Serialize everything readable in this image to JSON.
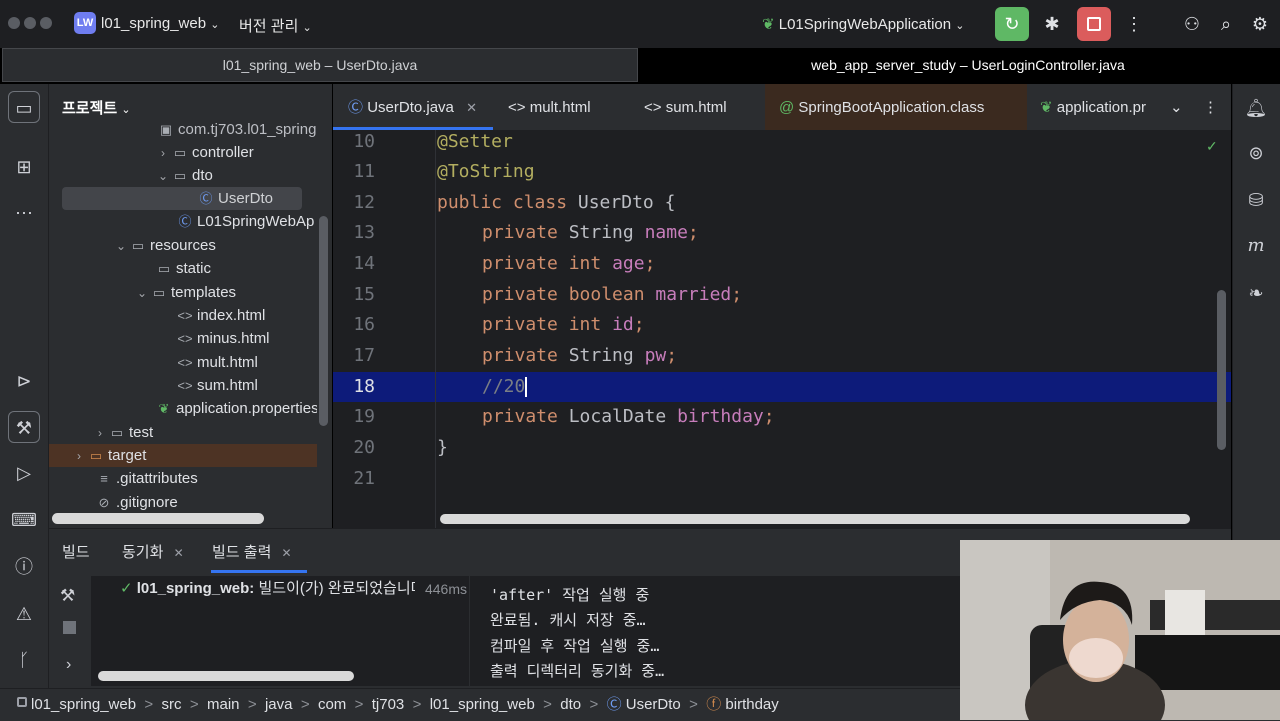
{
  "titlebar": {
    "project_badge": "LW",
    "project_name": "l01_spring_web",
    "vcs_label": "버전 관리",
    "run_config": "L01SpringWebApplication"
  },
  "window_tabs": {
    "left": "l01_spring_web – UserDto.java",
    "right": "web_app_server_study – UserLoginController.java"
  },
  "project_panel": {
    "header": "프로젝트",
    "tree": [
      {
        "label": "com.tj703.l01_spring",
        "icon": "package-icon"
      },
      {
        "label": "controller",
        "icon": "folder-icon"
      },
      {
        "label": "dto",
        "icon": "folder-icon"
      },
      {
        "label": "UserDto",
        "icon": "class-icon"
      },
      {
        "label": "L01SpringWebAp",
        "icon": "spring-class-icon"
      },
      {
        "label": "resources",
        "icon": "folder-icon"
      },
      {
        "label": "static",
        "icon": "folder-icon"
      },
      {
        "label": "templates",
        "icon": "folder-icon"
      },
      {
        "label": "index.html",
        "icon": "html-icon"
      },
      {
        "label": "minus.html",
        "icon": "html-icon"
      },
      {
        "label": "mult.html",
        "icon": "html-icon"
      },
      {
        "label": "sum.html",
        "icon": "html-icon"
      },
      {
        "label": "application.properties",
        "icon": "properties-icon"
      },
      {
        "label": "test",
        "icon": "folder-icon"
      },
      {
        "label": "target",
        "icon": "folder-icon"
      },
      {
        "label": ".gitattributes",
        "icon": "text-file-icon"
      },
      {
        "label": ".gitignore",
        "icon": "ignore-file-icon"
      }
    ]
  },
  "editor_tabs": [
    {
      "label": "UserDto.java"
    },
    {
      "label": "mult.html"
    },
    {
      "label": "sum.html"
    },
    {
      "label": "SpringBootApplication.class"
    },
    {
      "label": "application.pr"
    }
  ],
  "editor": {
    "line_numbers": [
      "10",
      "11",
      "12",
      "13",
      "14",
      "15",
      "16",
      "17",
      "18",
      "19",
      "20",
      "21"
    ],
    "current_line": "18",
    "lines": {
      "l10": "@Setter",
      "l11": "@ToString",
      "l12_kw": "public class",
      "l12_rest": " UserDto {",
      "l13_kw": "private",
      "l13_type": " String ",
      "l13_field": "name",
      "l14_kw": "private int",
      "l14_field": "age",
      "l15_kw": "private boolean",
      "l15_field": "married",
      "l16_kw": "private int",
      "l16_field": "id",
      "l17_kw": "private",
      "l17_type": " String ",
      "l17_field": "pw",
      "l18": "//20",
      "l19_kw": "private",
      "l19_type": " LocalDate ",
      "l19_field": "birthday",
      "l20": "}",
      "semi": ";"
    }
  },
  "build_panel": {
    "tabs": [
      "빌드",
      "동기화",
      "빌드 출력"
    ],
    "status_project": "l01_spring_web:",
    "status_text": "빌드이(가) 완료되었습니다",
    "status_time": "446ms",
    "output": [
      "'after' 작업 실행 중",
      "완료됨. 캐시 저장 중…",
      "컴파일 후 작업 실행 중…",
      "출력 디렉터리 동기화 중…"
    ]
  },
  "breadcrumb": [
    "l01_spring_web",
    "src",
    "main",
    "java",
    "com",
    "tj703",
    "l01_spring_web",
    "dto",
    "UserDto",
    "birthday"
  ],
  "colors": {
    "accent": "#3574f0",
    "run_button": "#5fb865",
    "stop_button": "#db5c5c",
    "current_line": "#0d1b7a"
  }
}
